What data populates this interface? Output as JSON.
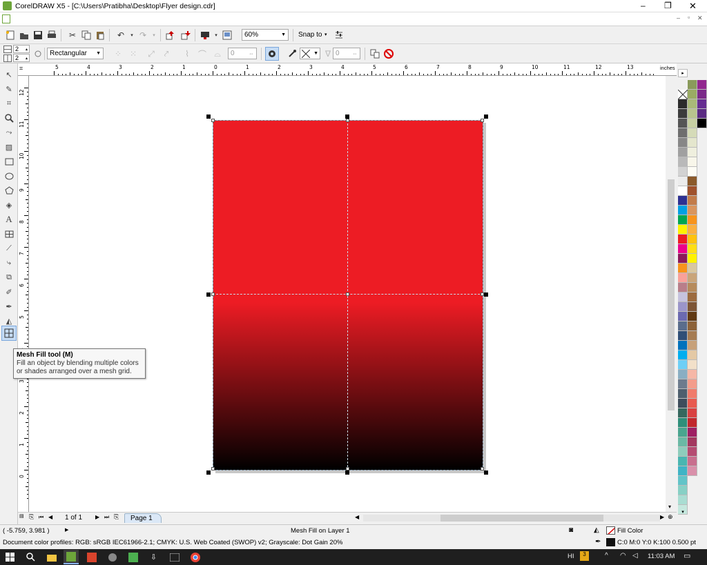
{
  "window": {
    "title": "CorelDRAW X5 - [C:\\Users\\Pratibha\\Desktop\\Flyer design.cdr]",
    "minimize": "–",
    "restore": "❐",
    "close": "✕",
    "doc_min": "–",
    "doc_restore": "▫",
    "doc_close": "✕"
  },
  "standard_toolbar": {
    "zoom_value": "60%",
    "snap_to_label": "Snap to"
  },
  "property_bar": {
    "rows_value": "2",
    "cols_value": "2",
    "selection_mode": "Rectangular",
    "smoothness_value": "0",
    "transparency_value": "0"
  },
  "ruler": {
    "unit_label": "inches",
    "h_labels": [
      "5",
      "4",
      "3",
      "2",
      "1",
      "0",
      "1",
      "2",
      "3",
      "4",
      "5",
      "6",
      "7",
      "8",
      "9",
      "10",
      "11",
      "12",
      "13"
    ],
    "v_labels": [
      "12",
      "11",
      "10",
      "9",
      "8",
      "7",
      "6",
      "5",
      "4",
      "3",
      "2",
      "1",
      "0"
    ]
  },
  "tooltip": {
    "title": "Mesh Fill tool (M)",
    "body": "Fill an object by blending multiple colors or shades arranged over a mesh grid."
  },
  "page_nav": {
    "page_count": "1 of 1",
    "page_tab": "Page 1"
  },
  "status": {
    "coordinates": "( -5.759, 3.981 )",
    "object_info": "Mesh Fill on Layer 1",
    "color_profiles": "Document color profiles: RGB: sRGB IEC61966-2.1; CMYK: U.S. Web Coated (SWOP) v2; Grayscale: Dot Gain 20%",
    "fill_label": "Fill Color",
    "outline_info": "C:0 M:0 Y:0 K:100  0.500 pt"
  },
  "taskbar": {
    "lang": "HI",
    "time": "11:03 AM"
  },
  "colors": {
    "mesh_top": "#ed1c24",
    "mesh_bottom": "#000000",
    "selected_tool_bg": "#c6dcf5"
  }
}
